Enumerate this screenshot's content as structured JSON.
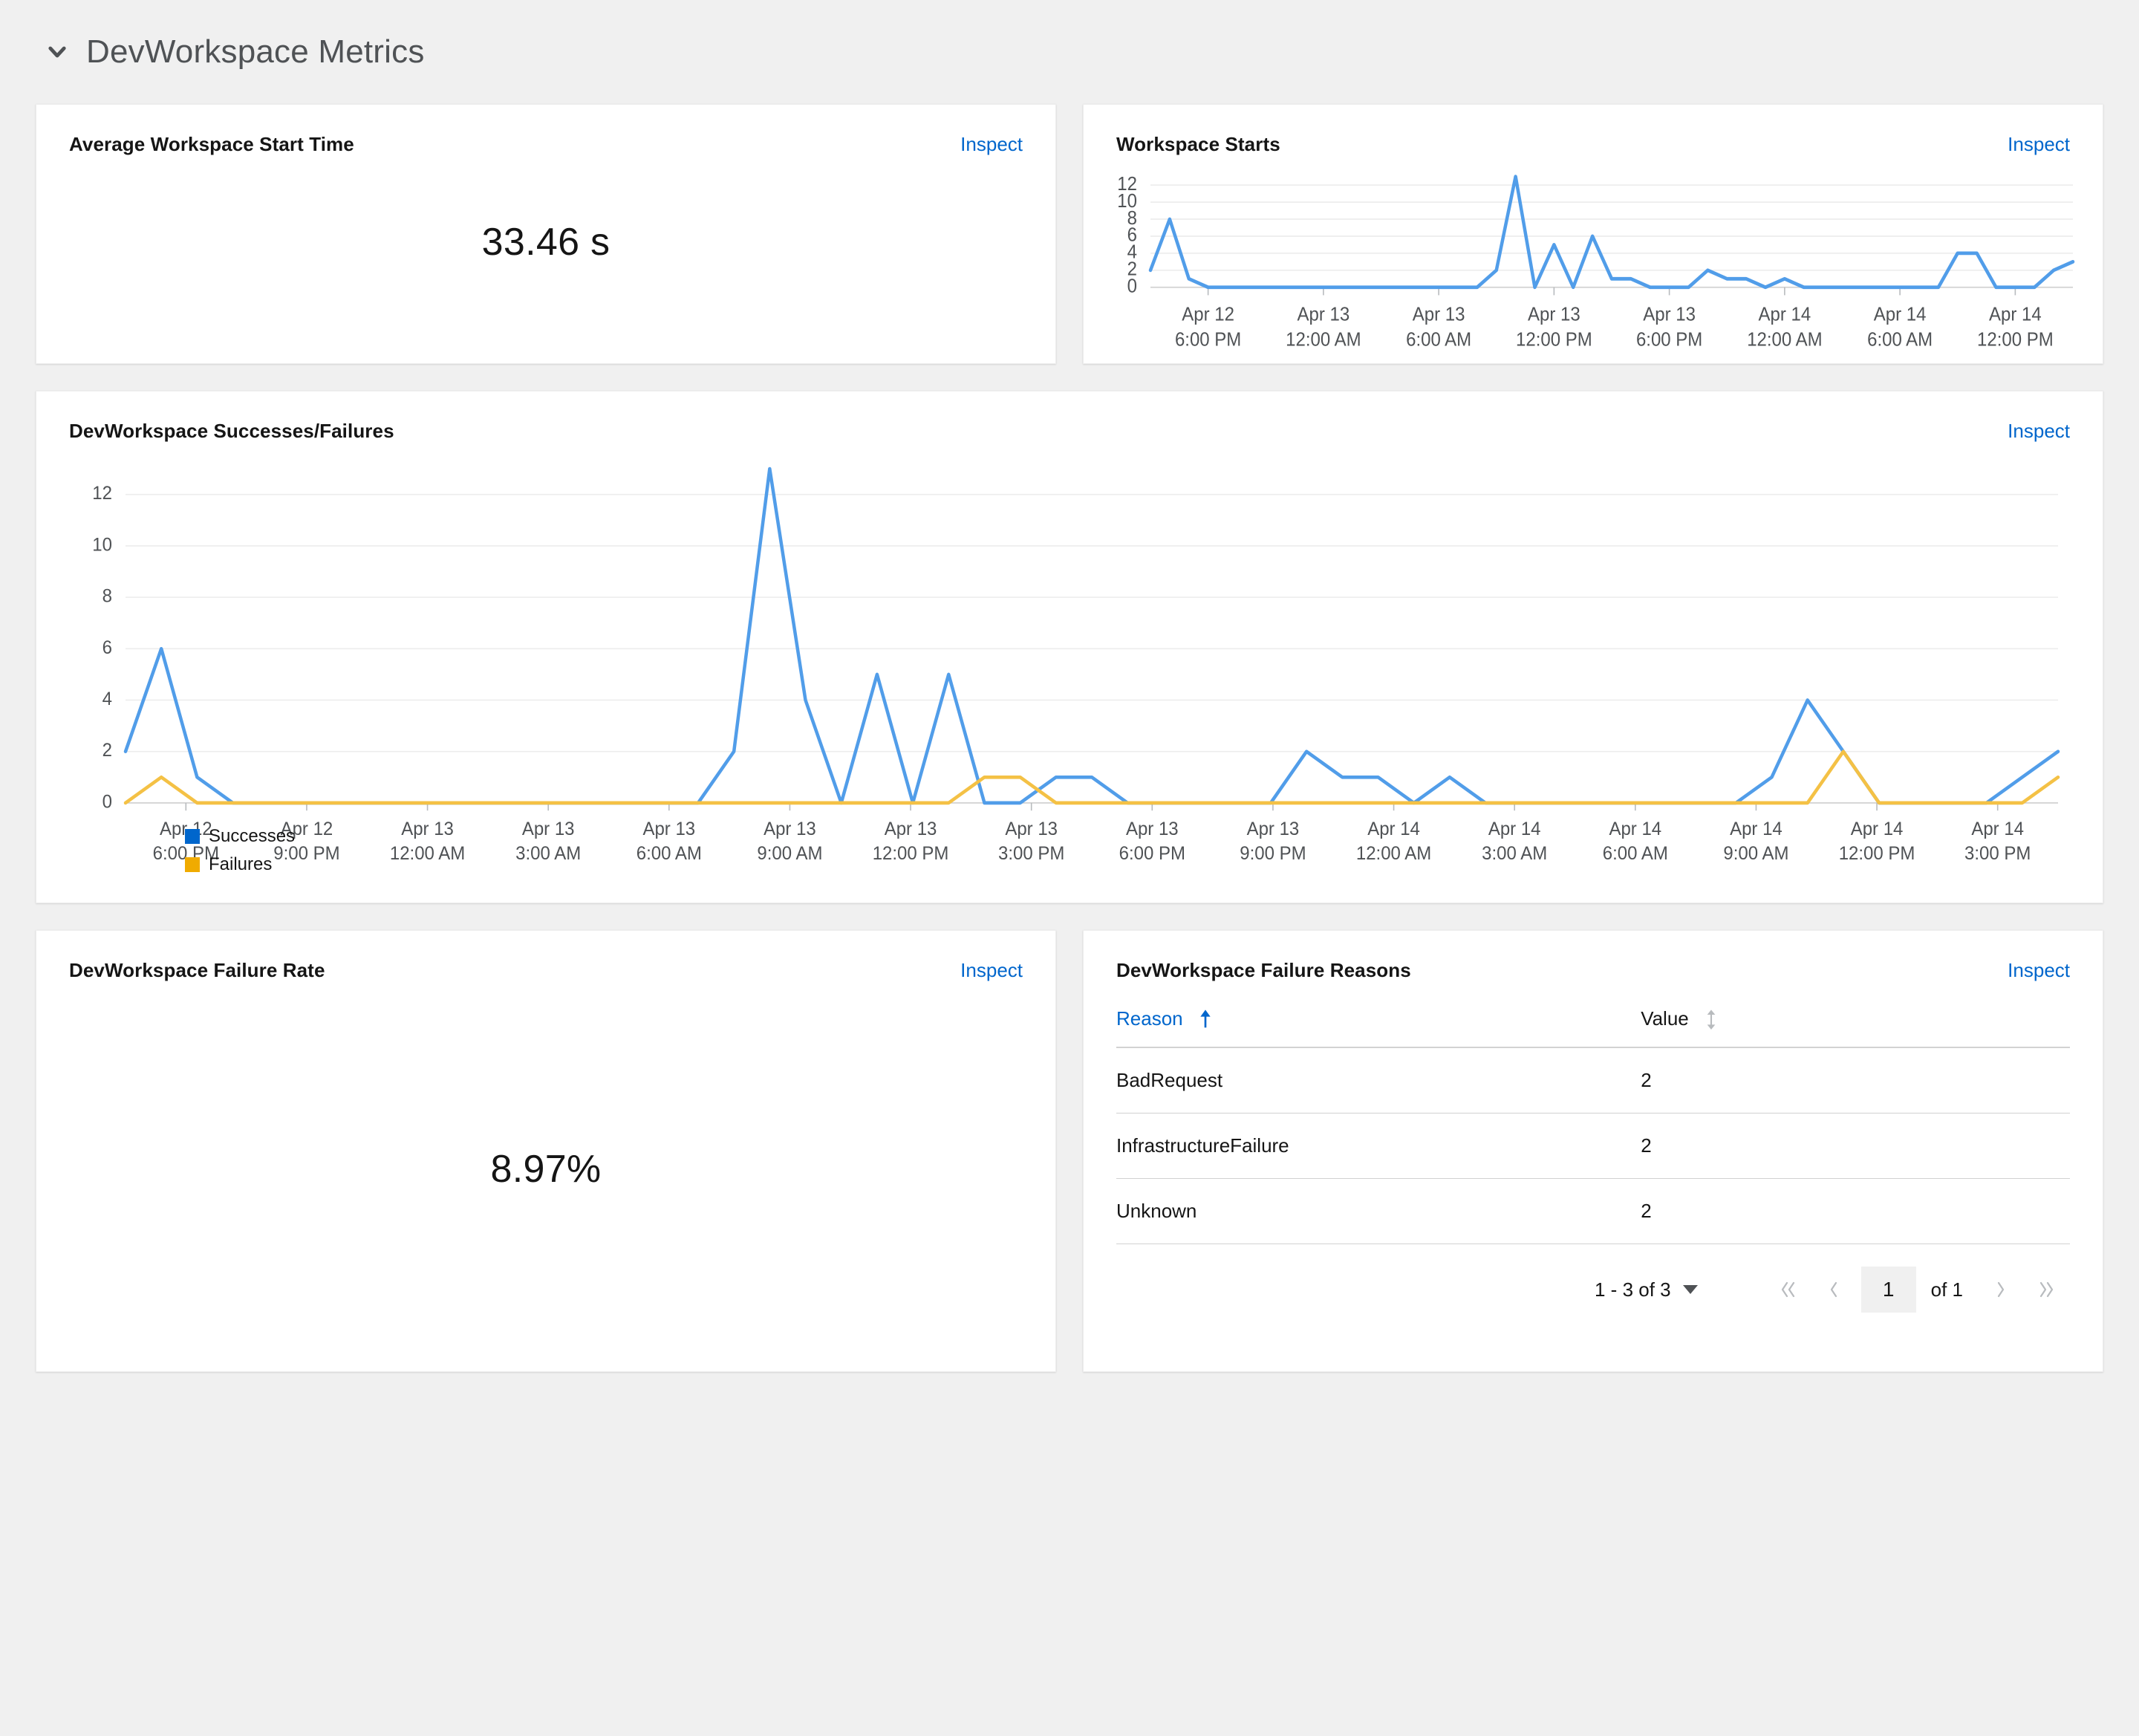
{
  "section": {
    "title": "DevWorkspace Metrics",
    "collapse_icon": "chevron-down-icon"
  },
  "colors": {
    "accent_link": "#0066CC",
    "successes": "#0066CC",
    "failures": "#F0AB00",
    "line_blue": "#519DE9",
    "line_yellow": "#F4C145",
    "grid": "#EDEDED",
    "text": "#151515",
    "text_muted": "#4F5255",
    "card_bg": "#FFFFFF",
    "page_bg": "#F0F0F0"
  },
  "cards": {
    "avg_start_time": {
      "title": "Average Workspace Start Time",
      "inspect_label": "Inspect",
      "value": "33.46 s"
    },
    "workspace_starts": {
      "title": "Workspace Starts",
      "inspect_label": "Inspect"
    },
    "successes_failures": {
      "title": "DevWorkspace Successes/Failures",
      "inspect_label": "Inspect"
    },
    "failure_rate": {
      "title": "DevWorkspace Failure Rate",
      "inspect_label": "Inspect",
      "value": "8.97%"
    },
    "failure_reasons": {
      "title": "DevWorkspace Failure Reasons",
      "inspect_label": "Inspect",
      "columns": [
        {
          "label": "Reason",
          "sort": "asc",
          "sort_icon": "sort-arrow-up-icon"
        },
        {
          "label": "Value",
          "sort": "none",
          "sort_icon": "sort-updown-icon"
        }
      ],
      "rows": [
        {
          "reason": "BadRequest",
          "value": "2"
        },
        {
          "reason": "InfrastructureFailure",
          "value": "2"
        },
        {
          "reason": "Unknown",
          "value": "2"
        }
      ],
      "pagination": {
        "range_label": "1 - 3 of 3",
        "first_icon": "angle-double-left-icon",
        "prev_icon": "angle-left-icon",
        "page_value": "1",
        "of_label": "of 1",
        "next_icon": "angle-right-icon",
        "last_icon": "angle-double-right-icon"
      }
    }
  },
  "chart_data": [
    {
      "id": "workspace_starts",
      "type": "line",
      "title": "Workspace Starts",
      "xlabel": "",
      "ylabel": "",
      "ylim": [
        0,
        13
      ],
      "yticks": [
        0,
        2,
        4,
        6,
        8,
        10,
        12
      ],
      "grid": true,
      "legend": "none",
      "xtick_labels": [
        "Apr 12\n6:00 PM",
        "Apr 13\n12:00 AM",
        "Apr 13\n6:00 AM",
        "Apr 13\n12:00 PM",
        "Apr 13\n6:00 PM",
        "Apr 14\n12:00 AM",
        "Apr 14\n6:00 AM",
        "Apr 14\n12:00 PM"
      ],
      "series": [
        {
          "name": "Workspace Starts",
          "color": "#519DE9",
          "values": [
            2,
            8,
            1,
            0,
            0,
            0,
            0,
            0,
            0,
            0,
            0,
            0,
            0,
            0,
            0,
            0,
            0,
            0,
            2,
            13,
            0,
            5,
            0,
            6,
            1,
            1,
            0,
            0,
            0,
            2,
            1,
            1,
            0,
            1,
            0,
            0,
            0,
            0,
            0,
            0,
            0,
            0,
            4,
            4,
            0,
            0,
            0,
            2,
            3
          ]
        }
      ]
    },
    {
      "id": "successes_failures",
      "type": "line",
      "title": "DevWorkspace Successes/Failures",
      "xlabel": "",
      "ylabel": "",
      "ylim": [
        0,
        13
      ],
      "yticks": [
        0,
        2,
        4,
        6,
        8,
        10,
        12
      ],
      "grid": true,
      "legend": "bottom-left",
      "xtick_labels": [
        "Apr 12\n6:00 PM",
        "Apr 12\n9:00 PM",
        "Apr 13\n12:00 AM",
        "Apr 13\n3:00 AM",
        "Apr 13\n6:00 AM",
        "Apr 13\n9:00 AM",
        "Apr 13\n12:00 PM",
        "Apr 13\n3:00 PM",
        "Apr 13\n6:00 PM",
        "Apr 13\n9:00 PM",
        "Apr 14\n12:00 AM",
        "Apr 14\n3:00 AM",
        "Apr 14\n6:00 AM",
        "Apr 14\n9:00 AM",
        "Apr 14\n12:00 PM",
        "Apr 14\n3:00 PM"
      ],
      "series": [
        {
          "name": "Successes",
          "color": "#519DE9",
          "legend_color": "#0066CC",
          "values": [
            2,
            6,
            1,
            0,
            0,
            0,
            0,
            0,
            0,
            0,
            0,
            0,
            0,
            0,
            0,
            0,
            0,
            2,
            13,
            4,
            0,
            5,
            0,
            5,
            0,
            0,
            1,
            1,
            0,
            0,
            0,
            0,
            0,
            2,
            1,
            1,
            0,
            1,
            0,
            0,
            0,
            0,
            0,
            0,
            0,
            0,
            1,
            4,
            2,
            0,
            0,
            0,
            0,
            1,
            2
          ]
        },
        {
          "name": "Failures",
          "color": "#F4C145",
          "legend_color": "#F0AB00",
          "values": [
            0,
            1,
            0,
            0,
            0,
            0,
            0,
            0,
            0,
            0,
            0,
            0,
            0,
            0,
            0,
            0,
            0,
            0,
            0,
            0,
            0,
            0,
            0,
            0,
            1,
            1,
            0,
            0,
            0,
            0,
            0,
            0,
            0,
            0,
            0,
            0,
            0,
            0,
            0,
            0,
            0,
            0,
            0,
            0,
            0,
            0,
            0,
            0,
            2,
            0,
            0,
            0,
            0,
            0,
            1
          ]
        }
      ]
    }
  ]
}
